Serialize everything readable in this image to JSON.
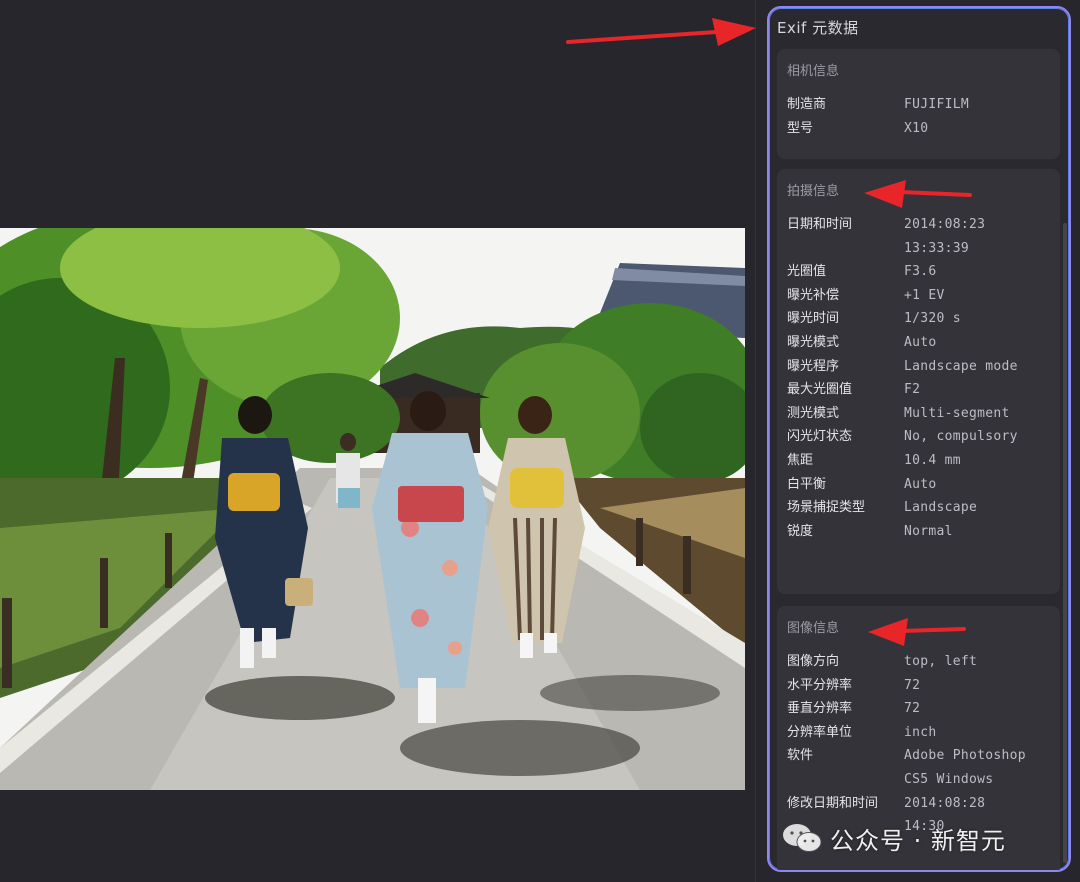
{
  "panel": {
    "title": "Exif 元数据",
    "sections": [
      {
        "title": "相机信息",
        "rows": [
          {
            "label": "制造商",
            "value": "FUJIFILM"
          },
          {
            "label": "型号",
            "value": "X10"
          }
        ]
      },
      {
        "title": "拍摄信息",
        "rows": [
          {
            "label": "日期和时间",
            "value": "2014:08:23",
            "value2": "13:33:39"
          },
          {
            "label": "光圈值",
            "value": "F3.6"
          },
          {
            "label": "曝光补偿",
            "value": "+1 EV"
          },
          {
            "label": "曝光时间",
            "value": "1/320 s"
          },
          {
            "label": "曝光模式",
            "value": "Auto"
          },
          {
            "label": "曝光程序",
            "value": "Landscape mode"
          },
          {
            "label": "最大光圈值",
            "value": "F2"
          },
          {
            "label": "测光模式",
            "value": "Multi-segment"
          },
          {
            "label": "闪光灯状态",
            "value": "No, compulsory"
          },
          {
            "label": "焦距",
            "value": "10.4 mm"
          },
          {
            "label": "白平衡",
            "value": "Auto"
          },
          {
            "label": "场景捕捉类型",
            "value": "Landscape"
          },
          {
            "label": "锐度",
            "value": "Normal"
          }
        ]
      },
      {
        "title": "图像信息",
        "rows": [
          {
            "label": "图像方向",
            "value": "top, left"
          },
          {
            "label": "水平分辨率",
            "value": "72"
          },
          {
            "label": "垂直分辨率",
            "value": "72"
          },
          {
            "label": "分辨率单位",
            "value": "inch"
          },
          {
            "label": "软件",
            "value": "Adobe Photoshop",
            "value2": "CS5 Windows"
          },
          {
            "label": "修改日期和时间",
            "value": "2014:08:28",
            "value2": "14:30"
          }
        ]
      }
    ]
  },
  "watermark": {
    "text": "公众号 · 新智元"
  },
  "colors": {
    "accent_border": "#8f86f0",
    "arrow": "#e8262a"
  }
}
